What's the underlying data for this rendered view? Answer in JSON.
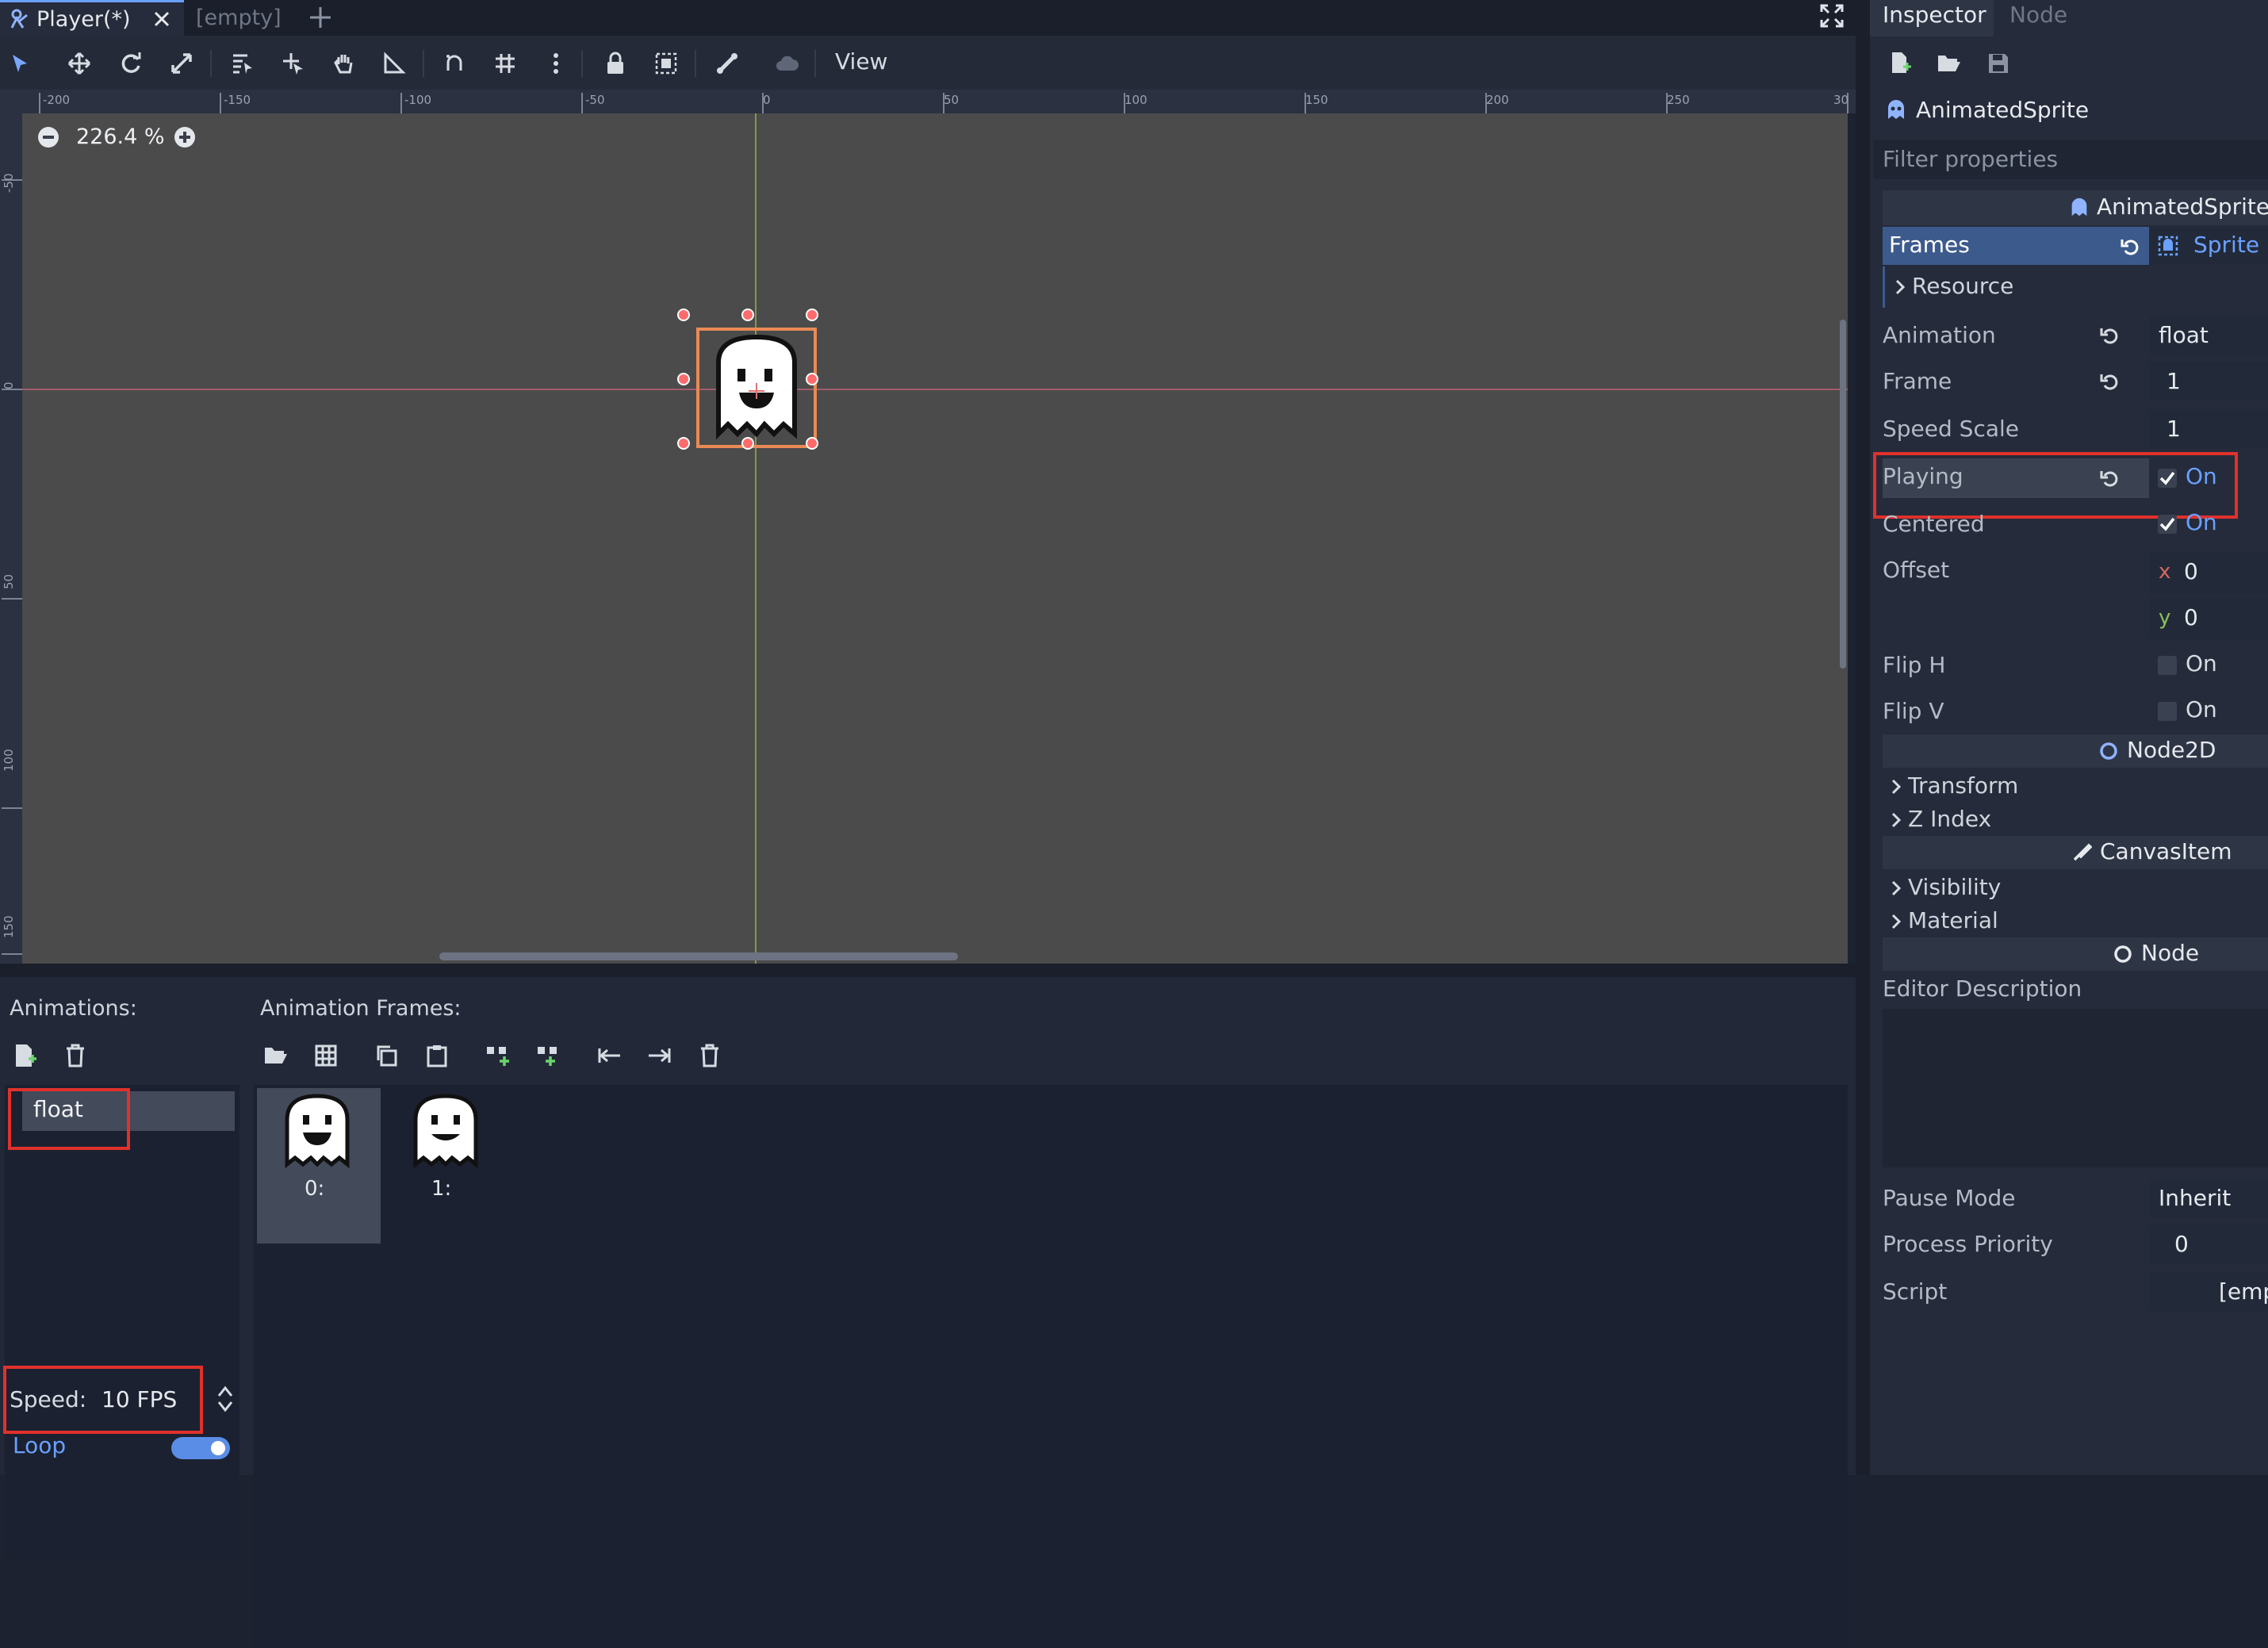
{
  "tabs": {
    "active": "Player(*)",
    "inactive": "[empty]"
  },
  "toolbar": {
    "view_label": "View"
  },
  "viewport": {
    "zoom": "226.4 %",
    "ruler_top": [
      "-200",
      "-150",
      "-100",
      "-50",
      "0",
      "50",
      "100",
      "150",
      "200",
      "250",
      "30"
    ],
    "ruler_left": [
      "-50",
      "0",
      "50",
      "100",
      "150"
    ]
  },
  "animations_panel": {
    "title": "Animations:",
    "items": [
      "float"
    ],
    "speed_label": "Speed:",
    "speed_value": "10 FPS",
    "loop_label": "Loop",
    "loop_on": true
  },
  "frames_panel": {
    "title": "Animation Frames:",
    "frames": [
      {
        "label": "0:"
      },
      {
        "label": "1:"
      }
    ]
  },
  "inspector": {
    "tabs": [
      "Inspector",
      "Node"
    ],
    "node_name": "AnimatedSprite",
    "filter_placeholder": "Filter properties",
    "class_header": "AnimatedSprite",
    "frames": {
      "label": "Frames",
      "value": "Sprite"
    },
    "resource_label": "Resource",
    "properties": {
      "animation": {
        "label": "Animation",
        "value": "float"
      },
      "frame": {
        "label": "Frame",
        "value": "1"
      },
      "speed_scale": {
        "label": "Speed Scale",
        "value": "1"
      },
      "playing": {
        "label": "Playing",
        "value": "On"
      },
      "centered": {
        "label": "Centered",
        "value": "On"
      },
      "offset": {
        "label": "Offset",
        "x_axis": "x",
        "x": "0",
        "y_axis": "y",
        "y": "0"
      },
      "flip_h": {
        "label": "Flip H",
        "value": "On"
      },
      "flip_v": {
        "label": "Flip V",
        "value": "On"
      }
    },
    "node2d_header": "Node2D",
    "transform_label": "Transform",
    "zindex_label": "Z Index",
    "canvasitem_header": "CanvasItem",
    "visibility_label": "Visibility",
    "material_label": "Material",
    "node_header": "Node",
    "editor_description_label": "Editor Description",
    "pause_mode": {
      "label": "Pause Mode",
      "value": "Inherit"
    },
    "process_priority": {
      "label": "Process Priority",
      "value": "0"
    },
    "script": {
      "label": "Script",
      "value": "[emp"
    }
  },
  "colors": {
    "accent": "#6aa0ff",
    "highlight_box": "#e0312b",
    "selection": "#3d5a8c"
  }
}
